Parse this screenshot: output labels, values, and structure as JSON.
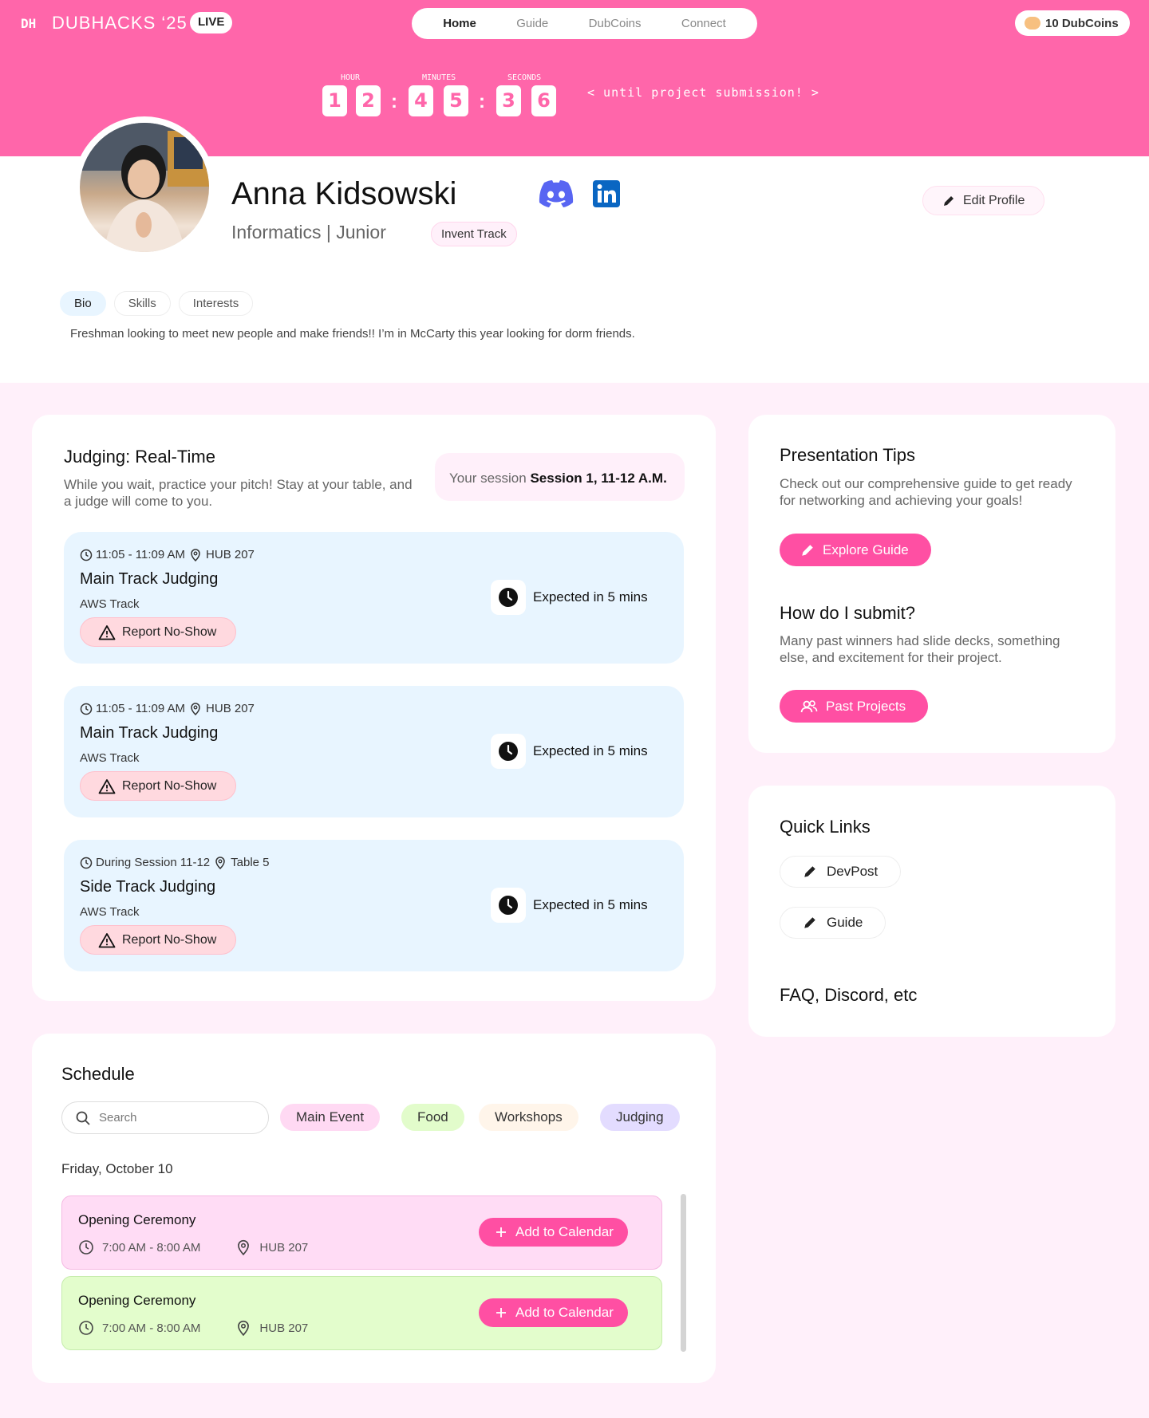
{
  "header": {
    "logo": "DH",
    "brand": "DUBHACKS ‘25",
    "live_badge": "LIVE",
    "nav": [
      "Home",
      "Guide",
      "DubCoins",
      "Connect"
    ],
    "active_nav": "Home",
    "coins": "10 DubCoins"
  },
  "countdown": {
    "labels": {
      "hour": "HOUR",
      "minutes": "MINUTES",
      "seconds": "SECONDS"
    },
    "digits": [
      "1",
      "2",
      "4",
      "5",
      "3",
      "6"
    ],
    "separator": ":",
    "caption": "< until project submission! >"
  },
  "profile": {
    "name": "Anna Kidsowski",
    "subtitle": "Informatics | Junior",
    "track": "Invent Track",
    "edit_label": "Edit Profile",
    "social_icons": [
      "discord-icon",
      "linkedin-icon"
    ],
    "tabs": [
      "Bio",
      "Skills",
      "Interests"
    ],
    "active_tab": "Bio",
    "bio": "Freshman looking to meet new people and make friends!! I’m in McCarty this year looking for dorm friends."
  },
  "judging": {
    "title": "Judging: Real-Time",
    "description": "While you wait, practice your pitch! Stay at your table, and a judge will come to you.",
    "session_label": "Your session",
    "session_value": "Session 1, 11-12 A.M.",
    "items": [
      {
        "time": "11:05 - 11:09 AM",
        "location": "HUB 207",
        "title": "Main Track Judging",
        "track": "AWS Track",
        "report": "Report No-Show",
        "expected": "Expected in 5 mins"
      },
      {
        "time": "11:05 - 11:09 AM",
        "location": "HUB 207",
        "title": "Main Track Judging",
        "track": "AWS Track",
        "report": "Report No-Show",
        "expected": "Expected in 5 mins"
      },
      {
        "time": "During Session 11-12",
        "location": "Table 5",
        "title": "Side Track Judging",
        "track": "AWS Track",
        "report": "Report No-Show",
        "expected": "Expected in 5 mins"
      }
    ]
  },
  "tips": {
    "title": "Presentation Tips",
    "text": "Check out our comprehensive guide to get ready for networking and achieving your goals!",
    "button": "Explore Guide",
    "submit_title": "How do I submit?",
    "submit_text": "Many past winners had slide decks, something else, and excitement for their project.",
    "submit_button": "Past Projects"
  },
  "quick_links": {
    "title": "Quick Links",
    "links": [
      "DevPost",
      "Guide"
    ],
    "footer": "FAQ, Discord, etc"
  },
  "schedule": {
    "title": "Schedule",
    "search_placeholder": "Search",
    "filters": [
      {
        "label": "Main Event",
        "color": "#ffd9f3"
      },
      {
        "label": "Food",
        "color": "#e2fccb"
      },
      {
        "label": "Workshops",
        "color": "#fff5ea"
      },
      {
        "label": "Judging",
        "color": "#e3dcff"
      }
    ],
    "date": "Friday, October 10",
    "events": [
      {
        "title": "Opening Ceremony",
        "time": "7:00 AM - 8:00 AM",
        "location": "HUB 207",
        "button": "Add to Calendar",
        "color": "#ffdcf5",
        "border": "#f5b9e3"
      },
      {
        "title": "Opening Ceremony",
        "time": "7:00 AM - 8:00 AM",
        "location": "HUB 207",
        "button": "Add to Calendar",
        "color": "#e3fdcc",
        "border": "#c6ecac"
      }
    ]
  },
  "colors": {
    "brand_pink": "#ff66aa",
    "button_pink": "#ff4fa3",
    "judging_bg": "#e8f5ff",
    "page_bg": "#fff0fa"
  }
}
